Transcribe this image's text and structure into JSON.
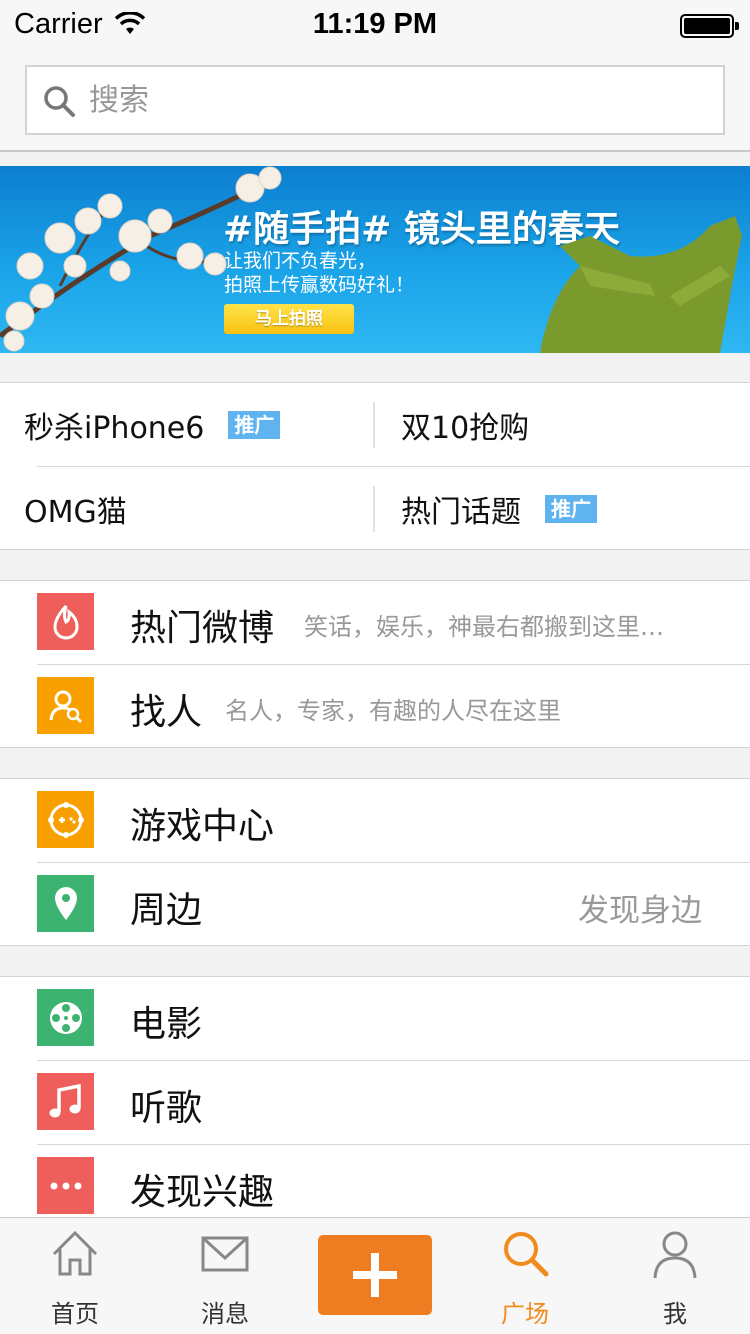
{
  "status_bar": {
    "carrier": "Carrier",
    "time": "11:19 PM"
  },
  "search": {
    "placeholder": "搜索"
  },
  "banner": {
    "title": "#随手拍# 镜头里的春天",
    "subtitle_line1": "让我们不负春光，",
    "subtitle_line2": "拍照上传赢数码好礼！",
    "button_label": "马上拍照"
  },
  "promo": [
    {
      "label": "秒杀iPhone6",
      "tag": "推广"
    },
    {
      "label": "双10抢购",
      "tag": ""
    },
    {
      "label": "OMG猫",
      "tag": ""
    },
    {
      "label": "热门话题",
      "tag": "推广"
    }
  ],
  "list": {
    "hot_weibo": {
      "label": "热门微博",
      "desc": "笑话，娱乐，神最右都搬到这里…",
      "icon": "flame-icon",
      "color": "#ee5f5b"
    },
    "find_people": {
      "label": "找人",
      "desc": "名人，专家，有趣的人尽在这里",
      "icon": "person-search-icon",
      "color": "#f7a000"
    },
    "game_center": {
      "label": "游戏中心",
      "icon": "gamepad-icon",
      "color": "#f7a000"
    },
    "nearby": {
      "label": "周边",
      "right": "发现身边",
      "icon": "location-pin-icon",
      "color": "#3cb371"
    },
    "movie": {
      "label": "电影",
      "icon": "film-reel-icon",
      "color": "#3cb371"
    },
    "music": {
      "label": "听歌",
      "icon": "music-note-icon",
      "color": "#ee5f5b"
    },
    "interests": {
      "label": "发现兴趣",
      "icon": "more-dots-icon",
      "color": "#ee5f5b"
    }
  },
  "tabbar": {
    "home": "首页",
    "messages": "消息",
    "discover": "广场",
    "me": "我",
    "active_color": "#f08c1e",
    "compose_color": "#ee7d22"
  }
}
